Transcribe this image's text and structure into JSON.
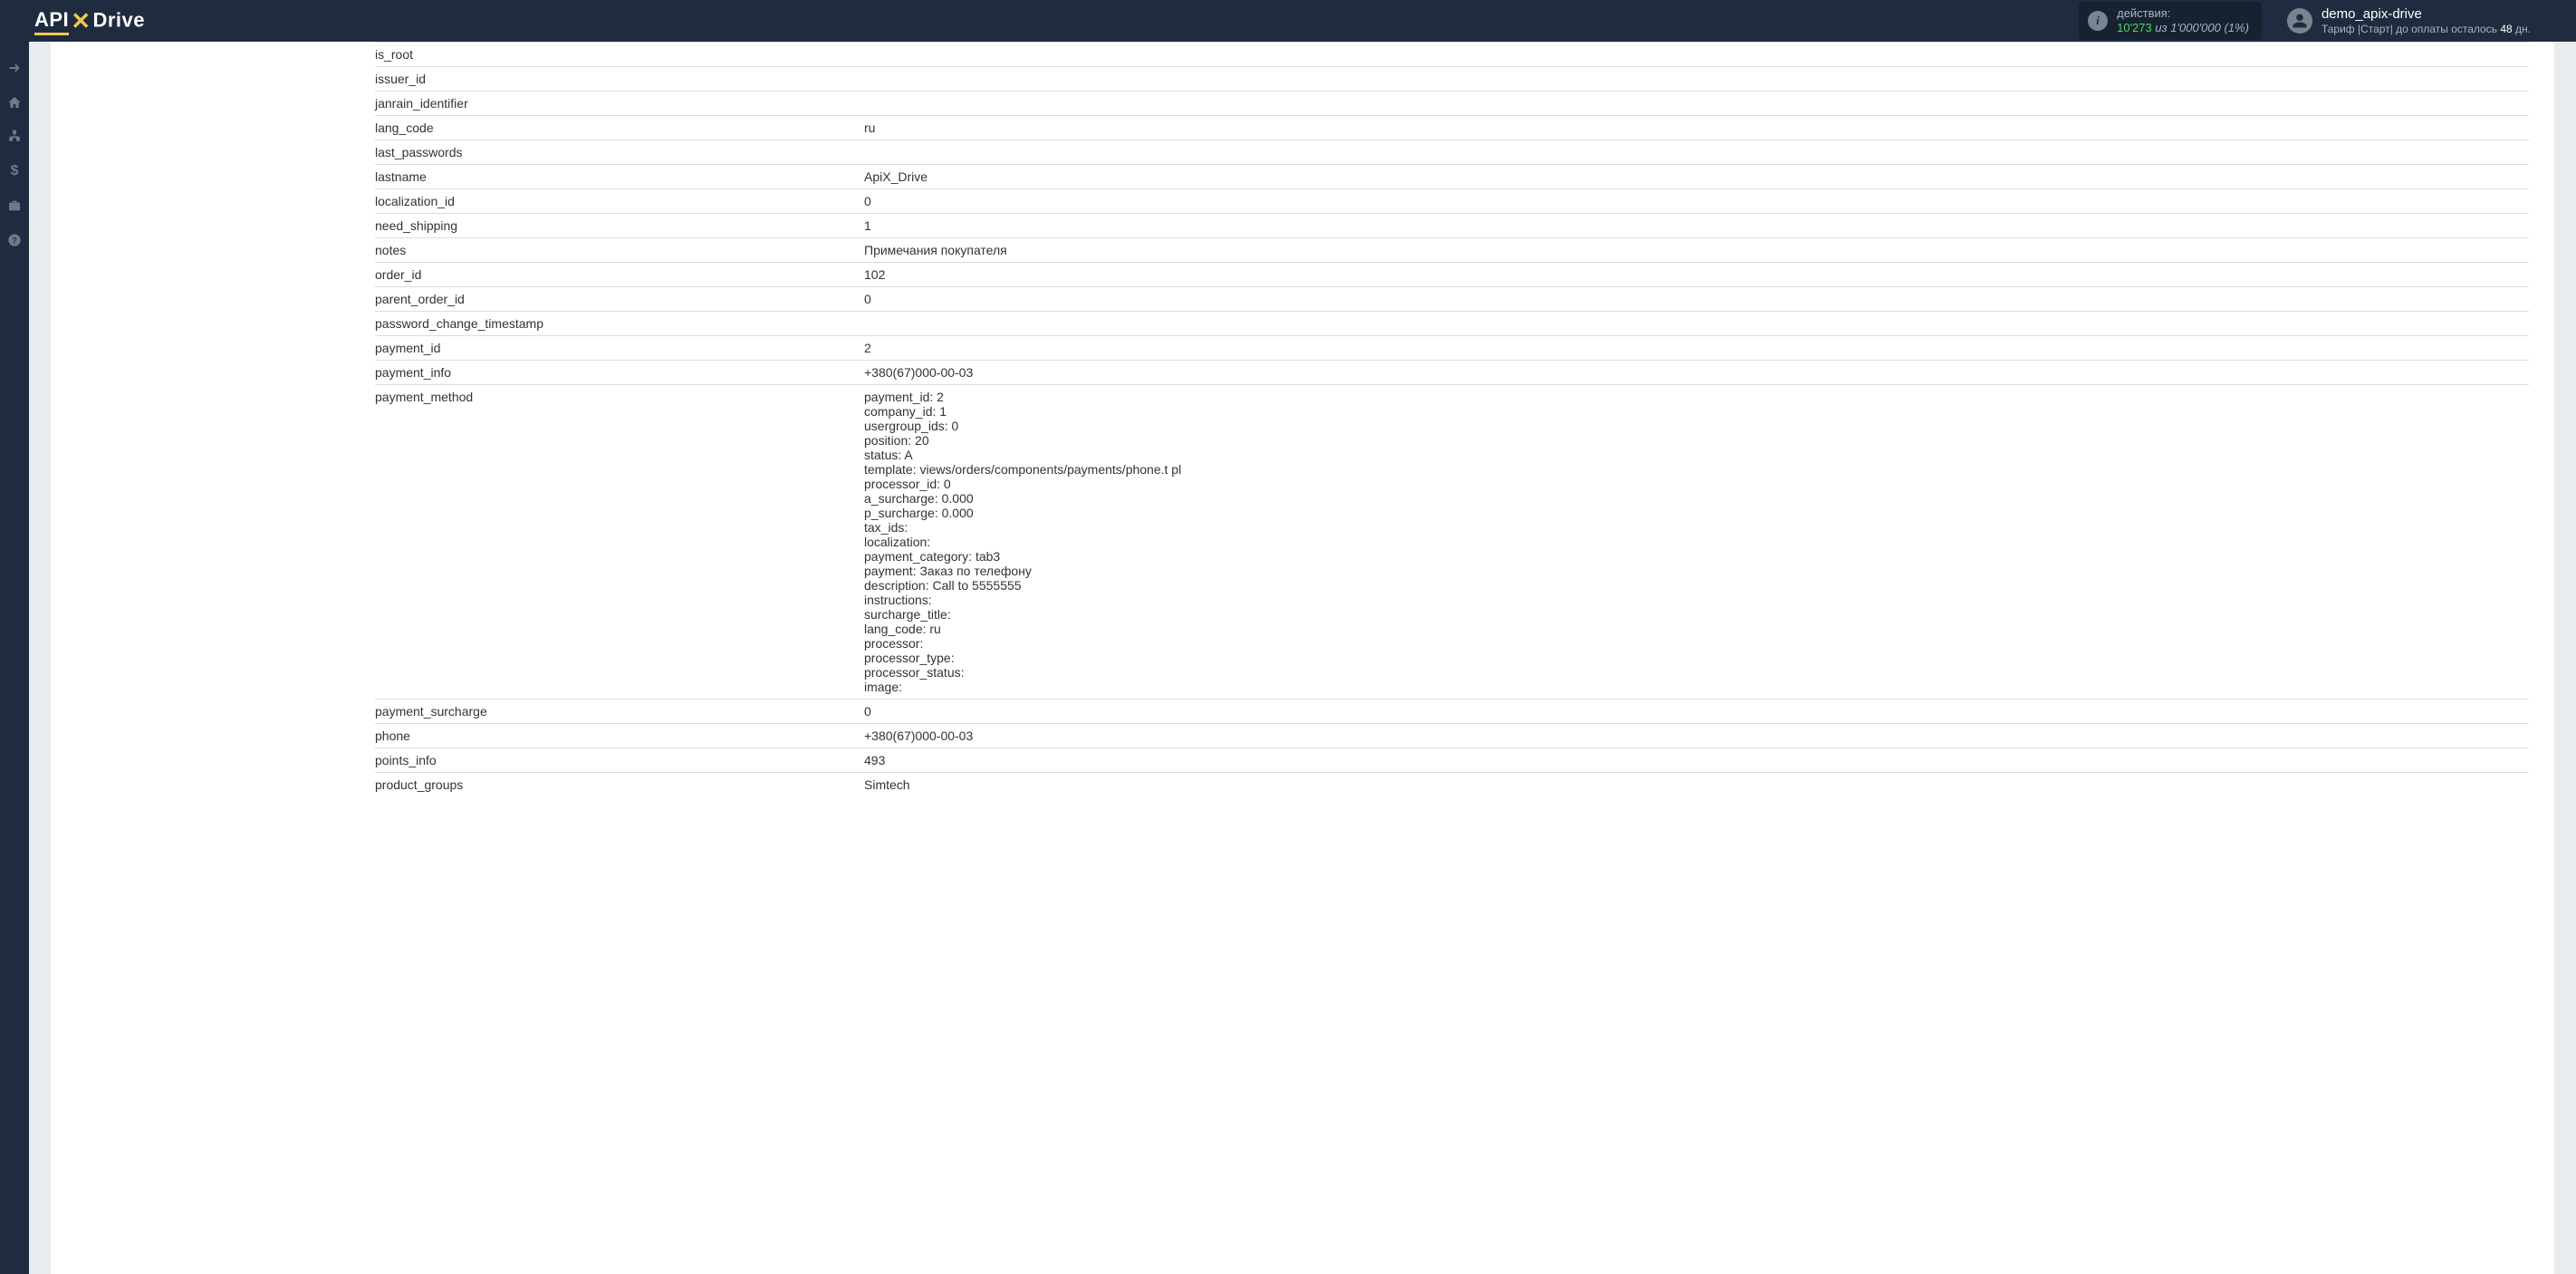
{
  "header": {
    "logo_api": "API",
    "logo_drive": "Drive",
    "actions_label": "действия:",
    "actions_current": "10'273",
    "actions_of": "из",
    "actions_max": "1'000'000",
    "actions_pct": "(1%)",
    "user_name": "demo_apix-drive",
    "user_plan_prefix": "Тариф |Старт| до оплаты осталось",
    "user_plan_days": "48",
    "user_plan_suffix": "дн."
  },
  "rows": [
    {
      "key": "is_root",
      "val": ""
    },
    {
      "key": "issuer_id",
      "val": ""
    },
    {
      "key": "janrain_identifier",
      "val": ""
    },
    {
      "key": "lang_code",
      "val": "ru"
    },
    {
      "key": "last_passwords",
      "val": ""
    },
    {
      "key": "lastname",
      "val": "ApiX_Drive"
    },
    {
      "key": "localization_id",
      "val": "0"
    },
    {
      "key": "need_shipping",
      "val": "1"
    },
    {
      "key": "notes",
      "val": "Примечания покупателя"
    },
    {
      "key": "order_id",
      "val": "102"
    },
    {
      "key": "parent_order_id",
      "val": "0"
    },
    {
      "key": "password_change_timestamp",
      "val": ""
    },
    {
      "key": "payment_id",
      "val": "2"
    },
    {
      "key": "payment_info",
      "val": "+380(67)000-00-03"
    },
    {
      "key": "payment_method",
      "val": "payment_id: 2\ncompany_id: 1\nusergroup_ids: 0\nposition: 20\nstatus: A\ntemplate: views/orders/components/payments/phone.t pl\nprocessor_id: 0\na_surcharge: 0.000\np_surcharge: 0.000\ntax_ids:\nlocalization:\npayment_category: tab3\npayment: Заказ по телефону\ndescription: Call to 5555555\ninstructions:\nsurcharge_title:\nlang_code: ru\nprocessor:\nprocessor_type:\nprocessor_status:\nimage:"
    },
    {
      "key": "payment_surcharge",
      "val": "0"
    },
    {
      "key": "phone",
      "val": "+380(67)000-00-03"
    },
    {
      "key": "points_info",
      "val": "493"
    },
    {
      "key": "product_groups",
      "val": "Simtech"
    }
  ]
}
